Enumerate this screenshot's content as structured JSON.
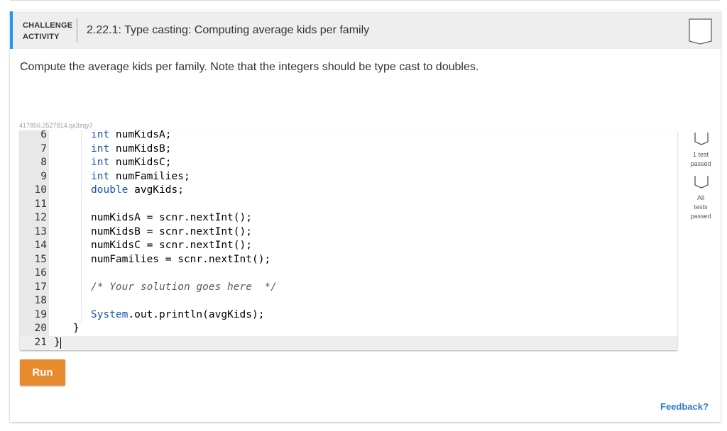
{
  "activity": {
    "kind_line1": "CHALLENGE",
    "kind_line2": "ACTIVITY",
    "title": "2.22.1: Type casting: Computing average kids per family",
    "instructions": "Compute the average kids per family. Note that the integers should be type cast to doubles.",
    "code_id": "417856.2527814.qx3zqy7"
  },
  "colors": {
    "accent": "#2196f3",
    "run_button": "#e88a2e",
    "feedback_link": "#2e7bcf",
    "keyword": "#1a55b0"
  },
  "editor": {
    "lines": [
      {
        "num": "6",
        "tokens": [
          {
            "t": "int",
            "k": "kw"
          },
          {
            "t": " numKidsA;"
          }
        ]
      },
      {
        "num": "7",
        "tokens": [
          {
            "t": "int",
            "k": "kw"
          },
          {
            "t": " numKidsB;"
          }
        ]
      },
      {
        "num": "8",
        "tokens": [
          {
            "t": "int",
            "k": "kw"
          },
          {
            "t": " numKidsC;"
          }
        ]
      },
      {
        "num": "9",
        "tokens": [
          {
            "t": "int",
            "k": "kw"
          },
          {
            "t": " numFamilies;"
          }
        ]
      },
      {
        "num": "10",
        "tokens": [
          {
            "t": "double",
            "k": "kw"
          },
          {
            "t": " avgKids;"
          }
        ]
      },
      {
        "num": "11",
        "tokens": []
      },
      {
        "num": "12",
        "tokens": [
          {
            "t": "numKidsA = scnr.nextInt();"
          }
        ]
      },
      {
        "num": "13",
        "tokens": [
          {
            "t": "numKidsB = scnr.nextInt();"
          }
        ]
      },
      {
        "num": "14",
        "tokens": [
          {
            "t": "numKidsC = scnr.nextInt();"
          }
        ]
      },
      {
        "num": "15",
        "tokens": [
          {
            "t": "numFamilies = scnr.nextInt();"
          }
        ]
      },
      {
        "num": "16",
        "tokens": []
      },
      {
        "num": "17",
        "tokens": [
          {
            "t": "/* Your solution goes here  */",
            "k": "cm"
          }
        ]
      },
      {
        "num": "18",
        "tokens": []
      },
      {
        "num": "19",
        "tokens": [
          {
            "t": "System",
            "k": "kw"
          },
          {
            "t": ".out.println(avgKids);"
          }
        ]
      },
      {
        "num": "20",
        "tokens": [
          {
            "t": "}"
          }
        ]
      },
      {
        "num": "21",
        "tokens": [
          {
            "t": "}"
          }
        ]
      }
    ]
  },
  "status": {
    "test1": "1 test passed",
    "test1_line1": "1 test",
    "test1_line2": "passed",
    "all_line1": "All tests",
    "all_line2": "passed"
  },
  "run_label": "Run",
  "feedback_label": "Feedback?"
}
